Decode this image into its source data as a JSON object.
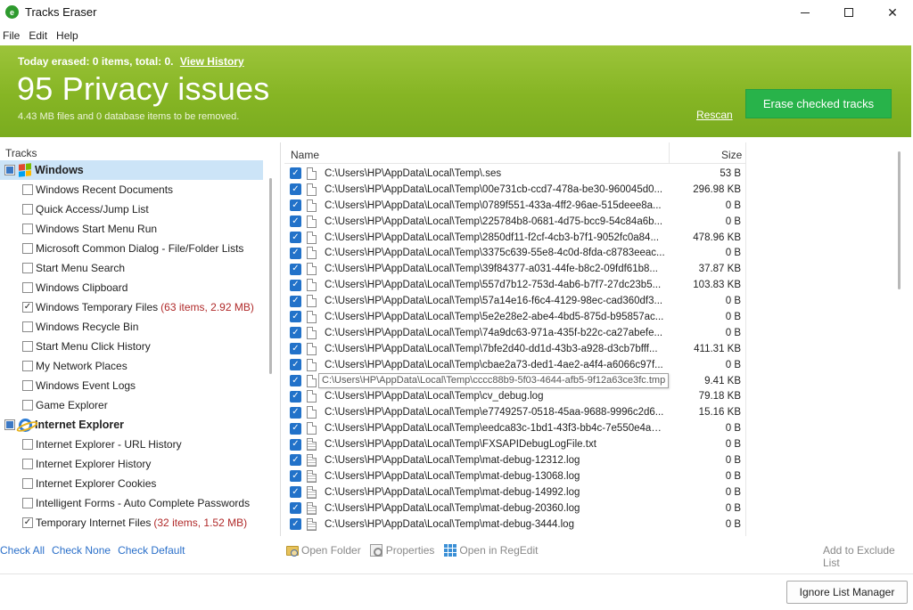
{
  "window": {
    "title": "Tracks Eraser",
    "icon_letter": "e"
  },
  "menu": [
    "File",
    "Edit",
    "Help"
  ],
  "banner": {
    "summary_text": "Today erased: 0 items, total: 0.",
    "history_link": "View History",
    "headline": "95 Privacy issues",
    "subtext": "4.43 MB files and 0 database items to be removed.",
    "rescan_link": "Rescan",
    "erase_button": "Erase checked tracks",
    "colors": {
      "banner": "#86b524",
      "erase_button": "#28b34a"
    }
  },
  "tracks": {
    "header": "Tracks",
    "groups": [
      {
        "label": "Windows",
        "icon": "windows-logo-icon",
        "items": [
          {
            "label": "Windows Recent Documents",
            "checked": false,
            "note": ""
          },
          {
            "label": "Quick Access/Jump List",
            "checked": false,
            "note": ""
          },
          {
            "label": "Windows Start Menu Run",
            "checked": false,
            "note": ""
          },
          {
            "label": "Microsoft Common Dialog - File/Folder Lists",
            "checked": false,
            "note": ""
          },
          {
            "label": "Start Menu Search",
            "checked": false,
            "note": ""
          },
          {
            "label": "Windows Clipboard",
            "checked": false,
            "note": ""
          },
          {
            "label": "Windows Temporary Files",
            "checked": true,
            "note": "(63 items, 2.92 MB)"
          },
          {
            "label": "Windows Recycle Bin",
            "checked": false,
            "note": ""
          },
          {
            "label": "Start Menu Click History",
            "checked": false,
            "note": ""
          },
          {
            "label": "My Network Places",
            "checked": false,
            "note": ""
          },
          {
            "label": "Windows Event Logs",
            "checked": false,
            "note": ""
          },
          {
            "label": "Game Explorer",
            "checked": false,
            "note": ""
          }
        ]
      },
      {
        "label": "Internet Explorer",
        "icon": "internet-explorer-icon",
        "items": [
          {
            "label": "Internet Explorer - URL History",
            "checked": false,
            "note": ""
          },
          {
            "label": "Internet Explorer History",
            "checked": false,
            "note": ""
          },
          {
            "label": "Internet Explorer Cookies",
            "checked": false,
            "note": ""
          },
          {
            "label": "Intelligent Forms - Auto Complete Passwords",
            "checked": false,
            "note": ""
          },
          {
            "label": "Temporary Internet Files",
            "checked": true,
            "note": "(32 items, 1.52 MB)"
          }
        ]
      }
    ],
    "check_all": "Check All",
    "check_none": "Check None",
    "check_default": "Check Default"
  },
  "files": {
    "columns": {
      "name": "Name",
      "size": "Size"
    },
    "rows": [
      {
        "path": "C:\\Users\\HP\\AppData\\Local\\Temp\\.ses",
        "size": "53 B",
        "type": "file"
      },
      {
        "path": "C:\\Users\\HP\\AppData\\Local\\Temp\\00e731cb-ccd7-478a-be30-960045d0...",
        "size": "296.98 KB",
        "type": "file"
      },
      {
        "path": "C:\\Users\\HP\\AppData\\Local\\Temp\\0789f551-433a-4ff2-96ae-515deee8a...",
        "size": "0 B",
        "type": "file"
      },
      {
        "path": "C:\\Users\\HP\\AppData\\Local\\Temp\\225784b8-0681-4d75-bcc9-54c84a6b...",
        "size": "0 B",
        "type": "file"
      },
      {
        "path": "C:\\Users\\HP\\AppData\\Local\\Temp\\2850df11-f2cf-4cb3-b7f1-9052fc0a84...",
        "size": "478.96 KB",
        "type": "file"
      },
      {
        "path": "C:\\Users\\HP\\AppData\\Local\\Temp\\3375c639-55e8-4c0d-8fda-c8783eeac...",
        "size": "0 B",
        "type": "file"
      },
      {
        "path": "C:\\Users\\HP\\AppData\\Local\\Temp\\39f84377-a031-44fe-b8c2-09fdf61b8...",
        "size": "37.87 KB",
        "type": "file"
      },
      {
        "path": "C:\\Users\\HP\\AppData\\Local\\Temp\\557d7b12-753d-4ab6-b7f7-27dc23b5...",
        "size": "103.83 KB",
        "type": "file"
      },
      {
        "path": "C:\\Users\\HP\\AppData\\Local\\Temp\\57a14e16-f6c4-4129-98ec-cad360df3...",
        "size": "0 B",
        "type": "file"
      },
      {
        "path": "C:\\Users\\HP\\AppData\\Local\\Temp\\5e2e28e2-abe4-4bd5-875d-b95857ac...",
        "size": "0 B",
        "type": "file"
      },
      {
        "path": "C:\\Users\\HP\\AppData\\Local\\Temp\\74a9dc63-971a-435f-b22c-ca27abefe...",
        "size": "0 B",
        "type": "file"
      },
      {
        "path": "C:\\Users\\HP\\AppData\\Local\\Temp\\7bfe2d40-dd1d-43b3-a928-d3cb7bfff...",
        "size": "411.31 KB",
        "type": "file"
      },
      {
        "path": "C:\\Users\\HP\\AppData\\Local\\Temp\\cbae2a73-ded1-4ae2-a4f4-a6066c97f...",
        "size": "0 B",
        "type": "file"
      },
      {
        "path": "C:\\Users\\HP\\AppData\\Local\\Temp\\cccc88b9-5f03-4644-afb5-9f12a63ce3fc.tmp",
        "size": "9.41 KB",
        "type": "file",
        "tooltip": true
      },
      {
        "path": "C:\\Users\\HP\\AppData\\Local\\Temp\\cv_debug.log",
        "size": "79.18 KB",
        "type": "file"
      },
      {
        "path": "C:\\Users\\HP\\AppData\\Local\\Temp\\e7749257-0518-45aa-9688-9996c2d6...",
        "size": "15.16 KB",
        "type": "file"
      },
      {
        "path": "C:\\Users\\HP\\AppData\\Local\\Temp\\eedca83c-1bd1-43f3-bb4c-7e550e4a9...",
        "size": "0 B",
        "type": "file"
      },
      {
        "path": "C:\\Users\\HP\\AppData\\Local\\Temp\\FXSAPIDebugLogFile.txt",
        "size": "0 B",
        "type": "log"
      },
      {
        "path": "C:\\Users\\HP\\AppData\\Local\\Temp\\mat-debug-12312.log",
        "size": "0 B",
        "type": "log"
      },
      {
        "path": "C:\\Users\\HP\\AppData\\Local\\Temp\\mat-debug-13068.log",
        "size": "0 B",
        "type": "log"
      },
      {
        "path": "C:\\Users\\HP\\AppData\\Local\\Temp\\mat-debug-14992.log",
        "size": "0 B",
        "type": "log"
      },
      {
        "path": "C:\\Users\\HP\\AppData\\Local\\Temp\\mat-debug-20360.log",
        "size": "0 B",
        "type": "log"
      },
      {
        "path": "C:\\Users\\HP\\AppData\\Local\\Temp\\mat-debug-3444.log",
        "size": "0 B",
        "type": "log"
      }
    ]
  },
  "toolbar": {
    "open_folder": "Open Folder",
    "properties": "Properties",
    "open_regedit": "Open in RegEdit",
    "add_exclude": "Add to Exclude List"
  },
  "footer": {
    "ignore_button": "Ignore List Manager"
  }
}
